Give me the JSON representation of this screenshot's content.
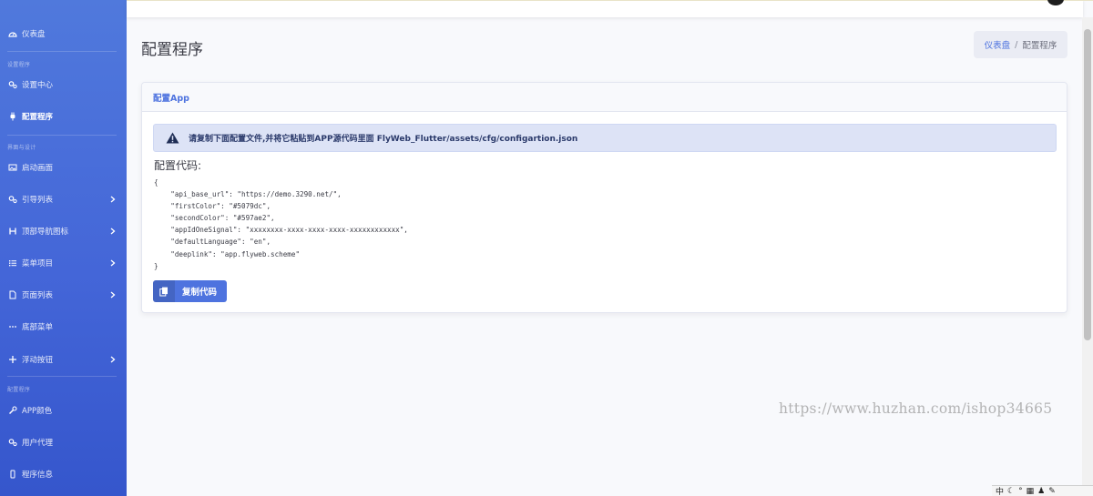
{
  "sidebar": {
    "dashboard": "仪表盘",
    "section_settings": "设置程序",
    "settings_center": "设置中心",
    "config_program": "配置程序",
    "section_ui": "界面与设计",
    "splash_screen": "启动画面",
    "guide_list": "引导列表",
    "top_nav_icons": "顶部导航图标",
    "menu_items": "菜单项目",
    "page_list": "页面列表",
    "bottom_menu": "底部菜单",
    "floating_button": "浮动按钮",
    "section_config": "配置程序",
    "app_colors": "APP颜色",
    "user_agent": "用户代理",
    "program_info": "程序信息"
  },
  "page": {
    "title": "配置程序"
  },
  "breadcrumb": {
    "home": "仪表盘",
    "separator": "/",
    "current": "配置程序"
  },
  "card": {
    "header": "配置App",
    "alert": "请复制下面配置文件,并将它粘贴到APP源代码里面 FlyWeb_Flutter/assets/cfg/configartion.json",
    "code_label": "配置代码:",
    "code": "{\n    \"api_base_url\": \"https://demo.3290.net/\",\n    \"firstColor\": \"#5079dc\",\n    \"secondColor\": \"#597ae2\",\n    \"appIdOneSignal\": \"xxxxxxxx-xxxx-xxxx-xxxx-xxxxxxxxxxxx\",\n    \"defaultLanguage\": \"en\",\n    \"deeplink\": \"app.flyweb.scheme\"\n}",
    "copy_button": "复制代码"
  },
  "watermark": "https://www.huzhan.com/ishop34665",
  "tray": {
    "ime": "中"
  },
  "colors": {
    "primary": "#4e73df",
    "sidebar": "#5079dc",
    "alert_bg": "#dde3f6"
  }
}
